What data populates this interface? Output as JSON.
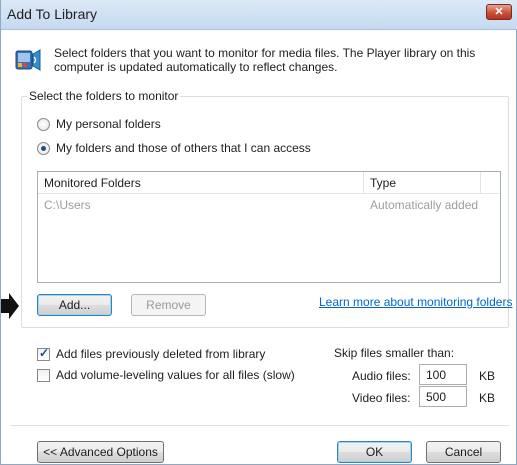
{
  "window": {
    "title": "Add To Library",
    "close_glyph": "✕"
  },
  "icon": {
    "name": "media-library-icon"
  },
  "description": "Select folders that you want to monitor for media files. The Player library on this computer is updated automatically to reflect changes.",
  "folders_group": {
    "label": "Select the folders to monitor",
    "options": [
      {
        "label": "My personal folders",
        "checked": false
      },
      {
        "label": "My folders and those of others that I can access",
        "checked": true
      }
    ]
  },
  "monitored_list": {
    "columns": [
      "Monitored Folders",
      "Type"
    ],
    "rows": [
      {
        "folder": "C:\\Users",
        "type": "Automatically added"
      }
    ]
  },
  "buttons": {
    "add": "Add...",
    "remove": "Remove",
    "advanced": "<< Advanced Options",
    "ok": "OK",
    "cancel": "Cancel"
  },
  "learn_more_link": "Learn more about monitoring folders",
  "options": {
    "add_deleted": {
      "label": "Add files previously deleted from library",
      "checked": true
    },
    "add_volume": {
      "label": "Add volume-leveling values for all files (slow)",
      "checked": false
    }
  },
  "skip": {
    "label": "Skip files smaller than:",
    "audio_label": "Audio files:",
    "audio_value": "100",
    "video_label": "Video files:",
    "video_value": "500",
    "unit": "KB"
  }
}
